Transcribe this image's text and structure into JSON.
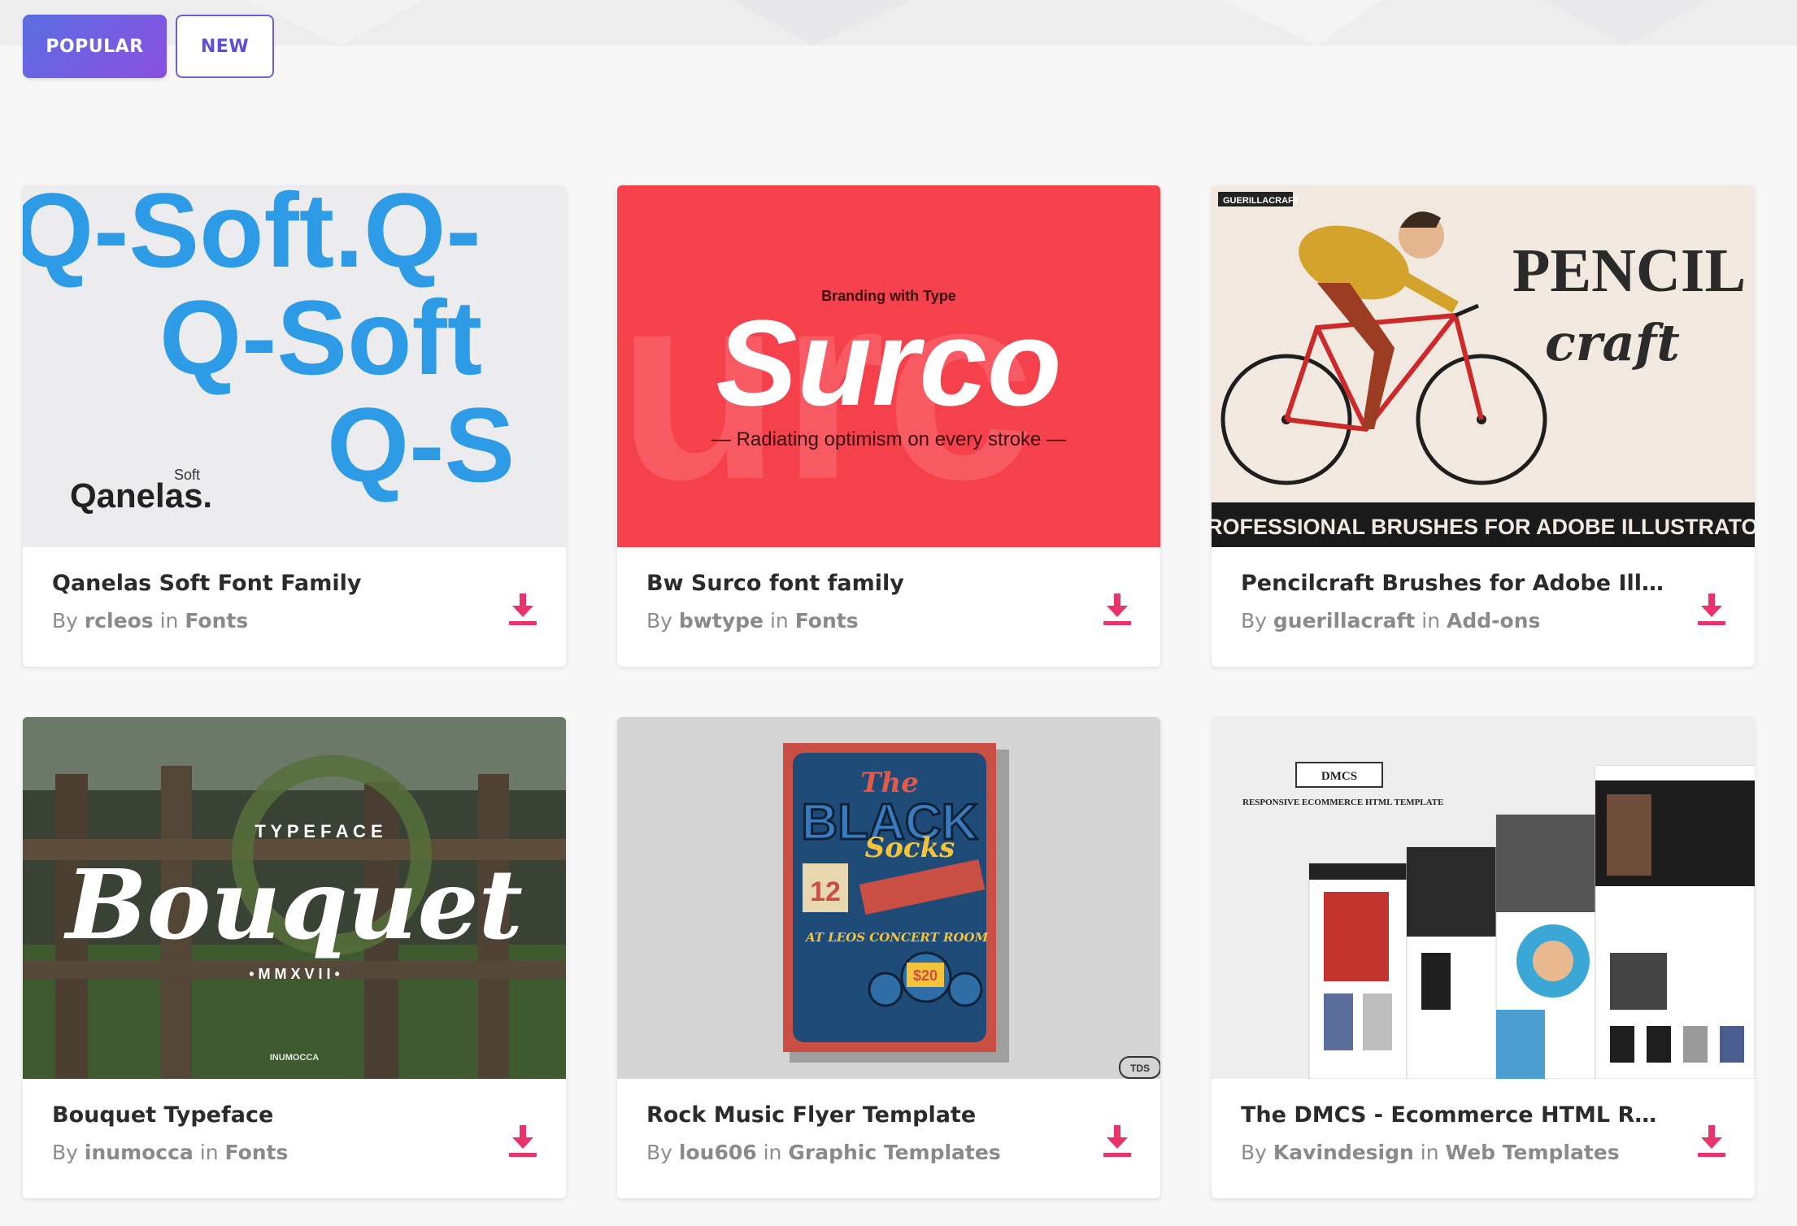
{
  "tabs": [
    {
      "label": "POPULAR",
      "active": true
    },
    {
      "label": "NEW",
      "active": false
    }
  ],
  "accent_color": "#e8336b",
  "cards": [
    {
      "title": "Qanelas Soft Font Family",
      "by_label": "By",
      "author": "rcleos",
      "in_label": "in",
      "category": "Fonts",
      "thumb": {
        "big_text_1": "Q-Soft.Q-",
        "big_text_2": "Q-Soft",
        "big_text_3": "Q-S",
        "logo_small": "Soft",
        "logo": "Qanelas."
      }
    },
    {
      "title": "Bw Surco font family",
      "by_label": "By",
      "author": "bwtype",
      "in_label": "in",
      "category": "Fonts",
      "thumb": {
        "kicker": "Branding with Type",
        "name": "Surco",
        "tagline": "— Radiating optimism on every stroke —"
      }
    },
    {
      "title": "Pencilcraft Brushes for Adobe Illust...",
      "by_label": "By",
      "author": "guerillacraft",
      "in_label": "in",
      "category": "Add-ons",
      "thumb": {
        "brand": "GUERILLACRAFT",
        "word1": "PENCIL",
        "word2": "craft",
        "banner": "PROFESSIONAL BRUSHES FOR ADOBE ILLUSTRATOR"
      }
    },
    {
      "title": "Bouquet Typeface",
      "by_label": "By",
      "author": "inumocca",
      "in_label": "in",
      "category": "Fonts",
      "thumb": {
        "kicker": "T Y P E F A C E",
        "name": "Bouquet",
        "year": "• M M X V I I •",
        "studio": "INUMOCCA"
      }
    },
    {
      "title": "Rock Music Flyer Template",
      "by_label": "By",
      "author": "lou606",
      "in_label": "in",
      "category": "Graphic Templates",
      "thumb": {
        "line1": "The",
        "line2": "BLACK",
        "line3": "Socks",
        "date": "12",
        "venue": "AT LEOS CONCERT ROOM",
        "price": "$20",
        "badge": "TDS"
      }
    },
    {
      "title": "The DMCS - Ecommerce HTML Resp...",
      "by_label": "By",
      "author": "Kavindesign",
      "in_label": "in",
      "category": "Web Templates",
      "thumb": {
        "logo": "DMCS",
        "tagline": "RESPONSIVE ECOMMERCE HTML TEMPLATE"
      }
    }
  ]
}
